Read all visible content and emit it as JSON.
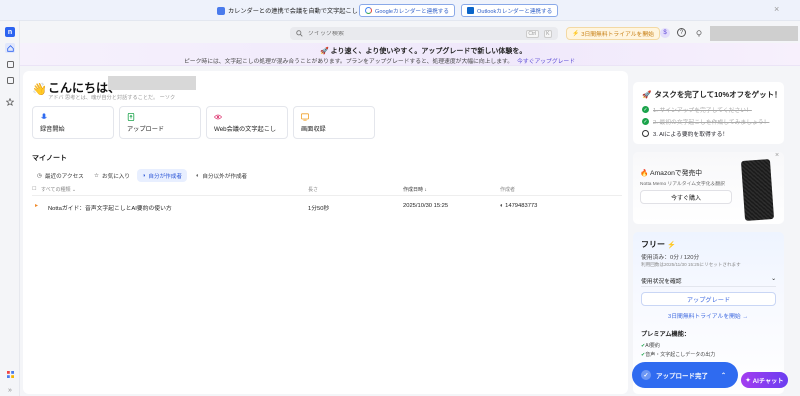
{
  "banner": {
    "message": "カレンダーとの連携で会議を自動で文字起こし",
    "google_btn": "Googleカレンダーと連携する",
    "outlook_btn": "Outlookカレンダーと連携する",
    "close": "×"
  },
  "header": {
    "search_placeholder": "クイック検索",
    "shortcut_ctrl": "Ctrl",
    "shortcut_k": "K",
    "trial_button": "3日間無料トライアルを開始",
    "badge": "$"
  },
  "promo": {
    "title": "より速く、より使いやすく。アップグレードで新しい体験を。",
    "text": "ピーク時には、文字起こしの処理が混み合うことがあります。プランをアップグレードすると、処理速度が大幅に向上します。",
    "link": "今すぐアップグレード"
  },
  "main": {
    "greeting": "こんにちは、",
    "emoji": "👋",
    "subtitle": "アドバ 思考とは、魂が自分と対話することだ。 ーソク",
    "quick_actions": [
      {
        "label": "録音開始"
      },
      {
        "label": "アップロード"
      },
      {
        "label": "Web会議の文字起こし"
      },
      {
        "label": "画面収録"
      }
    ],
    "mynote_title": "マイノート",
    "filters": [
      "最近のアクセス",
      "お気に入り",
      "自分が作成者",
      "自分以外が作成者"
    ],
    "table": {
      "headers": [
        "すべての種類",
        "長さ",
        "作成日時 ↓",
        "作成者"
      ],
      "rows": [
        {
          "title": "Nottaガイド：音声文字起こしとAI要約の使い方",
          "length": "1分50秒",
          "created": "2025/10/30 15:25",
          "author": "1479483773"
        }
      ]
    }
  },
  "task": {
    "title": "タスクを完了して10%オフをゲット！",
    "items": [
      {
        "text": "1. サインアップを完了してください！",
        "done": true
      },
      {
        "text": "2. 最初の文字起こしを作成してみましょう！",
        "done": true
      },
      {
        "text": "3. AIによる要約を取得する！",
        "done": false
      }
    ]
  },
  "amazon": {
    "title": "Amazonで発売中",
    "subtitle": "Notta Memo リアルタイム文字化＆翻訳",
    "buy": "今すぐ購入"
  },
  "plan": {
    "name": "フリー",
    "usage": "使用済み：0分 / 120分",
    "reset": "利用回数は2025/11/30 15:25にリセットされます",
    "check_usage": "使用状況を確認",
    "upgrade": "アップグレード",
    "trial_link": "3日間無料トライアルを開始 →",
    "premium_title": "プレミアム機能：",
    "features": [
      "AI要約",
      "音声・文字起こしデータの出力"
    ]
  },
  "floating": {
    "upload_done": "アップロード完了",
    "ai_chat": "AIチャット"
  },
  "colors": {
    "accent": "#2f6bf0",
    "success": "#1aa34a",
    "promo_link": "#5b4bd6"
  }
}
